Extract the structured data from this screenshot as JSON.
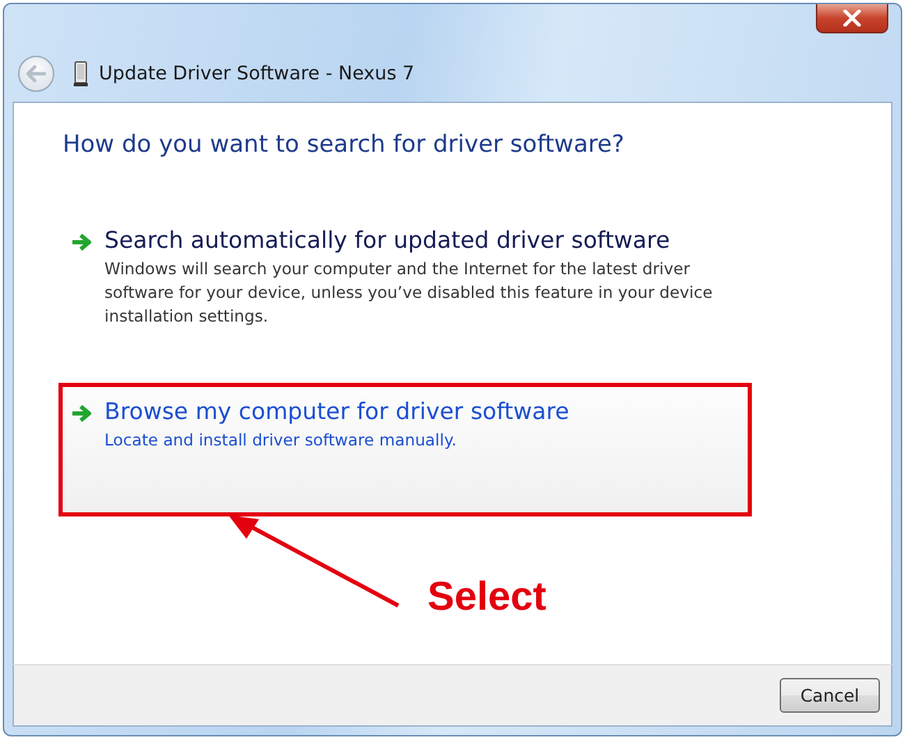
{
  "window": {
    "title": "Update Driver Software - Nexus 7"
  },
  "heading": "How do you want to search for driver software?",
  "options": [
    {
      "title": "Search automatically for updated driver software",
      "description": "Windows will search your computer and the Internet for the latest driver software for your device, unless you’ve disabled this feature in your device installation settings.",
      "selected": false,
      "callout": false
    },
    {
      "title": "Browse my computer for driver software",
      "description": "Locate and install driver software manually.",
      "selected": true,
      "callout": true
    }
  ],
  "annotation": {
    "label": "Select"
  },
  "buttons": [
    "Cancel"
  ]
}
